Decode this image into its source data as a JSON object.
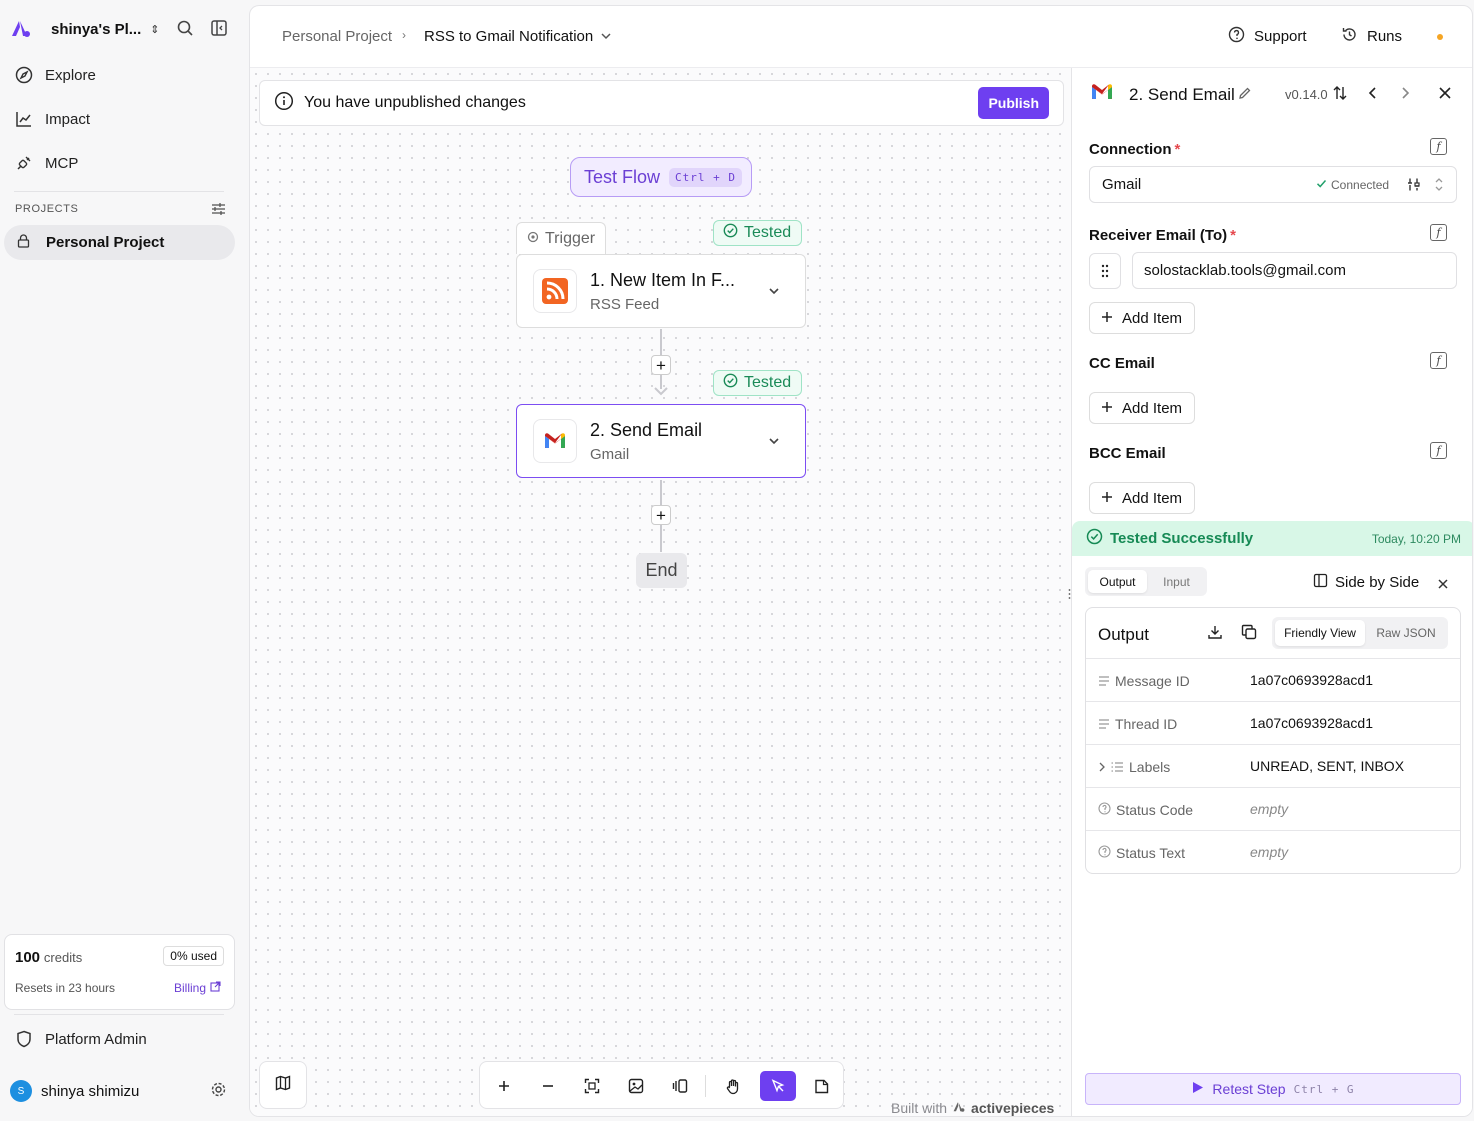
{
  "sidebar": {
    "workspace_name": "shinya's Pl...",
    "nav": [
      {
        "label": "Explore",
        "icon": "compass-icon"
      },
      {
        "label": "Impact",
        "icon": "line-chart-icon"
      },
      {
        "label": "MCP",
        "icon": "plug-icon"
      }
    ],
    "projects_header": "PROJECTS",
    "project": "Personal Project",
    "credits": {
      "amount": "100",
      "unit": "credits",
      "used": "0% used",
      "resets": "Resets in 23 hours",
      "billing": "Billing"
    },
    "platform_admin": "Platform Admin",
    "user": {
      "initial": "S",
      "name": "shinya shimizu"
    }
  },
  "header": {
    "breadcrumb_project": "Personal Project",
    "breadcrumb_flow": "RSS to Gmail Notification",
    "support": "Support",
    "runs": "Runs"
  },
  "canvas": {
    "banner": "You have unpublished changes",
    "publish": "Publish",
    "test_flow": "Test Flow",
    "test_flow_shortcut": "Ctrl + D",
    "trigger_tab": "Trigger",
    "tested_label": "Tested",
    "steps": [
      {
        "title": "1. New Item In F...",
        "subtitle": "RSS Feed",
        "icon": "rss-icon"
      },
      {
        "title": "2. Send Email",
        "subtitle": "Gmail",
        "icon": "gmail-icon"
      }
    ],
    "end_label": "End",
    "built_with": "Built with",
    "brand": "activepieces"
  },
  "panel": {
    "title": "2. Send Email",
    "version": "v0.14.0",
    "connection_label": "Connection",
    "connection_value": "Gmail",
    "connected_text": "Connected",
    "receiver_label": "Receiver Email (To)",
    "receiver_value": "solostacklab.tools@gmail.com",
    "add_item": "Add Item",
    "cc_label": "CC Email",
    "bcc_label": "BCC Email",
    "tested_status": "Tested Successfully",
    "tested_time": "Today, 10:20 PM",
    "tab_output": "Output",
    "tab_input": "Input",
    "side_by_side": "Side by Side",
    "output_title": "Output",
    "friendly_view": "Friendly View",
    "raw_json": "Raw JSON",
    "output_rows": [
      {
        "key": "Message ID",
        "value": "1a07c0693928acd1",
        "empty": false
      },
      {
        "key": "Thread ID",
        "value": "1a07c0693928acd1",
        "empty": false
      },
      {
        "key": "Labels",
        "value": "UNREAD, SENT, INBOX",
        "empty": false
      },
      {
        "key": "Status Code",
        "value": "empty",
        "empty": true
      },
      {
        "key": "Status Text",
        "value": "empty",
        "empty": true
      }
    ],
    "retest": "Retest Step",
    "retest_shortcut": "Ctrl + G"
  },
  "colors": {
    "accent": "#6e3ff0",
    "success": "#168a55",
    "success_bg": "#d8f7e7"
  }
}
